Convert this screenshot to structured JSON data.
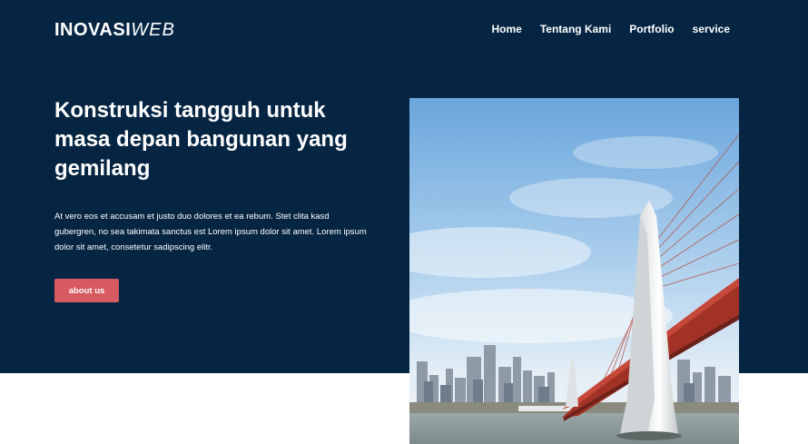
{
  "brand": {
    "logo_bold": "INOVASI",
    "logo_light": "WEB"
  },
  "nav": {
    "items": [
      {
        "label": "Home"
      },
      {
        "label": "Tentang Kami"
      },
      {
        "label": "Portfolio"
      },
      {
        "label": "service"
      }
    ]
  },
  "hero": {
    "title": "Konstruksi tangguh untuk masa depan bangunan yang gemilang",
    "paragraph": "At vero eos et accusam et justo duo dolores et ea rebum. Stet clita kasd gubergren, no sea takimata sanctus est Lorem ipsum dolor sit amet. Lorem ipsum dolor sit amet, consetetur sadipscing elitr.",
    "button_label": "about us"
  },
  "colors": {
    "hero_background": "#062543",
    "button": "#d65a5f",
    "text": "#ffffff"
  }
}
